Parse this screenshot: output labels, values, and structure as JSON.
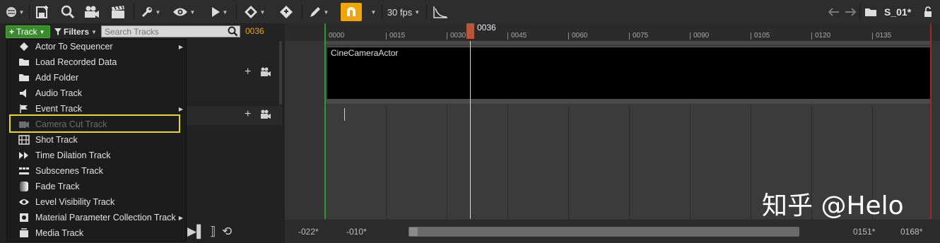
{
  "toolbar": {
    "fps_label": "30 fps",
    "sequence_name": "S_01*",
    "icons": [
      "world-icon",
      "save-icon",
      "search-icon",
      "camera-icon",
      "clapper-icon",
      "wrench-icon",
      "eye-icon",
      "play-icon",
      "key-icon",
      "key-diamond-icon",
      "pencil-icon",
      "magnet-icon",
      "curve-icon",
      "back-icon",
      "forward-icon",
      "folder-icon",
      "lock-icon"
    ]
  },
  "track_panel": {
    "track_button_label": "Track",
    "filters_label": "Filters",
    "search_placeholder": "Search Tracks",
    "current_frame": "0036"
  },
  "menu": {
    "items": [
      {
        "label": "Actor To Sequencer",
        "icon": "actor-icon",
        "submenu": true,
        "disabled": false
      },
      {
        "label": "Load Recorded Data",
        "icon": "folder-icon",
        "submenu": false,
        "disabled": false
      },
      {
        "label": "Add Folder",
        "icon": "folder-icon",
        "submenu": false,
        "disabled": false
      },
      {
        "label": "Audio Track",
        "icon": "audio-icon",
        "submenu": false,
        "disabled": false
      },
      {
        "label": "Event Track",
        "icon": "event-flag-icon",
        "submenu": true,
        "disabled": false
      },
      {
        "label": "Camera Cut Track",
        "icon": "camera-cut-icon",
        "submenu": false,
        "disabled": true
      },
      {
        "label": "Shot Track",
        "icon": "film-icon",
        "submenu": false,
        "disabled": false
      },
      {
        "label": "Time Dilation Track",
        "icon": "time-dilation-icon",
        "submenu": false,
        "disabled": false
      },
      {
        "label": "Subscenes Track",
        "icon": "subscenes-icon",
        "submenu": false,
        "disabled": false
      },
      {
        "label": "Fade Track",
        "icon": "fade-icon",
        "submenu": false,
        "disabled": false
      },
      {
        "label": "Level Visibility Track",
        "icon": "eye-icon",
        "submenu": false,
        "disabled": false
      },
      {
        "label": "Material Parameter Collection Track",
        "icon": "material-icon",
        "submenu": true,
        "disabled": false
      },
      {
        "label": "Media Track",
        "icon": "media-icon",
        "submenu": false,
        "disabled": false
      }
    ]
  },
  "timeline": {
    "ticks": [
      "0000",
      "0015",
      "0030",
      "0045",
      "0060",
      "0075",
      "0090",
      "0105",
      "0120",
      "0135"
    ],
    "playhead_label": "0036",
    "camera_track_label": "CineCameraActor",
    "view_start": "-022*",
    "work_start": "-010*",
    "work_end": "0151*",
    "view_end": "0168*"
  },
  "watermark": "知乎 @Helo",
  "colors": {
    "track_button": "#3a8a2e",
    "snap_active": "#f0a60a",
    "playhead": "#b8563c",
    "current_frame": "#e6a21e",
    "highlight": "#e8d43a"
  }
}
